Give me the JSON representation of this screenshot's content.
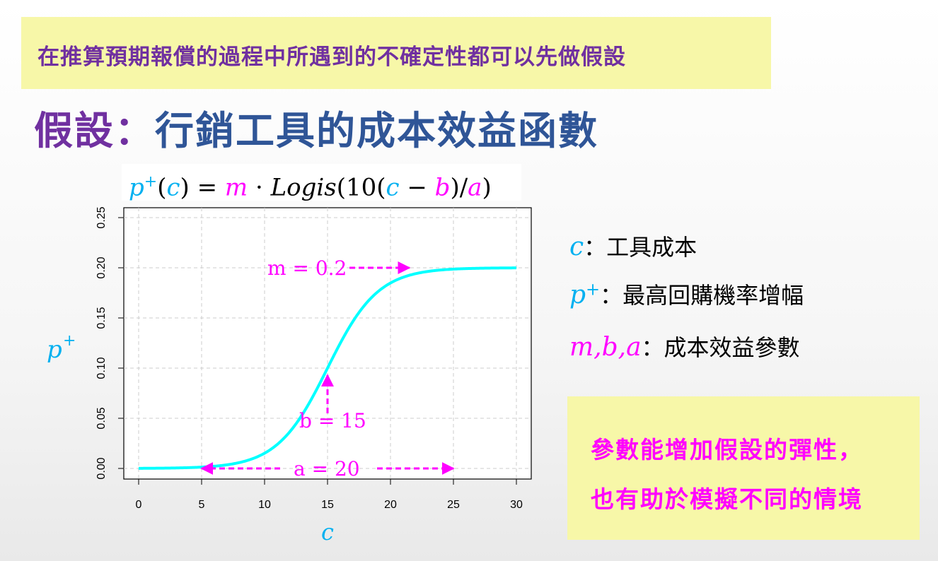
{
  "banner": {
    "text": "在推算預期報償的過程中所遇到的不確定性都可以先做假設"
  },
  "title": {
    "part1": "假設：",
    "part2": "行銷工具的成本效益函數"
  },
  "formula": {
    "p": "p",
    "sup": "+",
    "c": "c",
    "eq": " = ",
    "m": "m",
    "dot": " · ",
    "fn": "Logis",
    "open": "(10(",
    "minus": " − ",
    "b": "b",
    "close": ")/",
    "a": "a",
    "end": ")"
  },
  "legend": [
    {
      "symbol": "c",
      "symbol_sup": "",
      "symbol_color": "#00b0f0",
      "text": "：工具成本"
    },
    {
      "symbol": "p",
      "symbol_sup": "+",
      "symbol_color": "#00b0f0",
      "text": "：最高回購機率增幅"
    },
    {
      "symbol": "m,b,a",
      "symbol_sup": "",
      "symbol_color": "#ff00ff",
      "text": "：成本效益參數"
    }
  ],
  "note": {
    "line1": "參數能增加假設的彈性，",
    "line2": "也有助於模擬不同的情境"
  },
  "chart_data": {
    "type": "line",
    "function": "p+(c) = m · Logis(10(c − b)/a)",
    "params": {
      "m": 0.2,
      "b": 15,
      "a": 20
    },
    "x_range": [
      0,
      30
    ],
    "ylim": [
      0,
      0.25
    ],
    "x_ticks": [
      0,
      5,
      10,
      15,
      20,
      25,
      30
    ],
    "y_ticks": [
      "0.00",
      "0.05",
      "0.10",
      "0.15",
      "0.20",
      "0.25"
    ],
    "xlabel": "c",
    "ylabel": "p",
    "ylabel_sup": "+",
    "grid": true,
    "line_color": "#00ffff",
    "annotation_color": "#ff00ff",
    "annotations": {
      "m": {
        "label": "m = 0.2",
        "value": 0.2
      },
      "b": {
        "label": "b = 15",
        "value": 15
      },
      "a": {
        "label": "a = 20",
        "from": 5,
        "to": 25
      }
    }
  }
}
